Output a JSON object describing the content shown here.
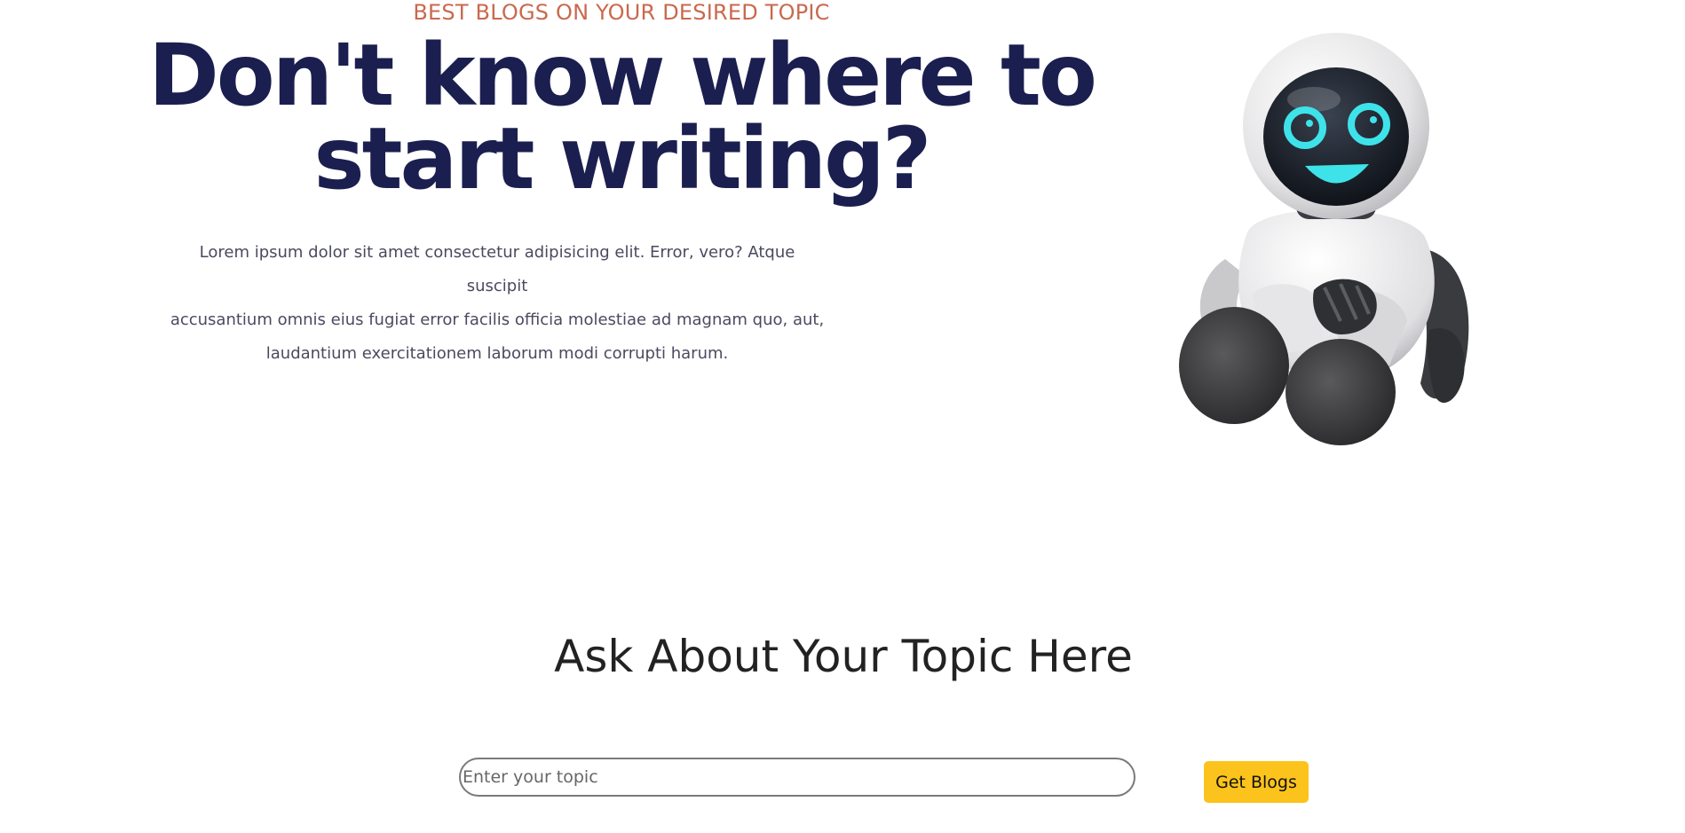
{
  "hero": {
    "eyebrow": "BEST BLOGS ON YOUR DESIRED TOPIC",
    "title_line1": "Don't know where to",
    "title_line2": "start writing?",
    "paragraph_line1": "Lorem ipsum dolor sit amet consectetur adipisicing elit. Error, vero? Atque suscipit",
    "paragraph_line2": "accusantium omnis eius fugiat error facilis officia molestiae ad magnam quo, aut,",
    "paragraph_line3": "laudantium exercitationem laborum modi corrupti harum.",
    "image_icon": "robot-illustration"
  },
  "search": {
    "heading": "Ask About Your Topic Here",
    "input_value": "",
    "input_placeholder": "Enter your topic",
    "button_label": "Get Blogs"
  },
  "colors": {
    "eyebrow": "#c9694e",
    "title": "#1b1f4f",
    "button": "#fbc31c",
    "robot_face_glow": "#3ee3ea"
  }
}
